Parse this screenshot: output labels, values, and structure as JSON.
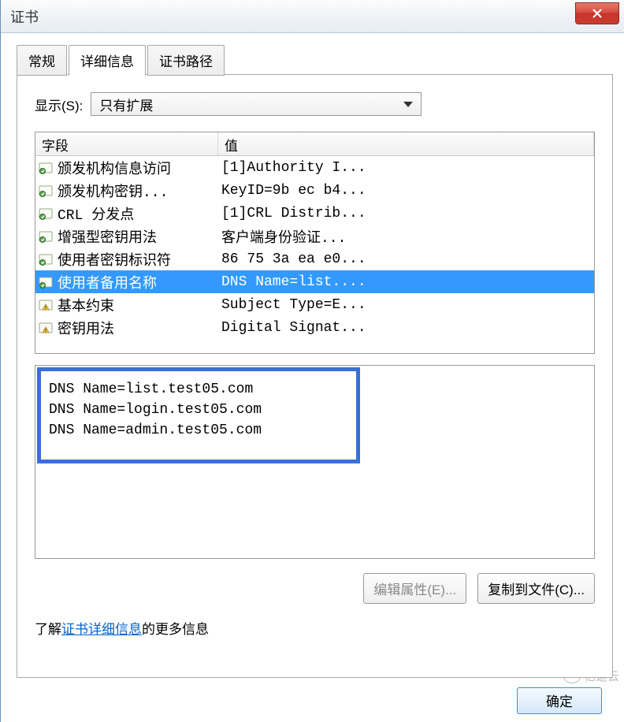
{
  "window": {
    "title": "证书"
  },
  "tabs": {
    "general": "常规",
    "details": "详细信息",
    "certpath": "证书路径"
  },
  "show": {
    "label": "显示(S):",
    "value": "只有扩展"
  },
  "table": {
    "header_field": "字段",
    "header_value": "值",
    "rows": [
      {
        "icon": "ext",
        "field": "颁发机构信息访问",
        "value": "[1]Authority I..."
      },
      {
        "icon": "ext",
        "field": "颁发机构密钥...",
        "value": "KeyID=9b ec b4..."
      },
      {
        "icon": "ext",
        "field": "CRL 分发点",
        "value": "[1]CRL Distrib..."
      },
      {
        "icon": "ext",
        "field": "增强型密钥用法",
        "value": "客户端身份验证..."
      },
      {
        "icon": "ext",
        "field": "使用者密钥标识符",
        "value": "86 75 3a ea e0..."
      },
      {
        "icon": "ext",
        "field": "使用者备用名称",
        "value": "DNS Name=list....",
        "selected": true
      },
      {
        "icon": "warn",
        "field": "基本约束",
        "value": "Subject Type=E..."
      },
      {
        "icon": "warn",
        "field": "密钥用法",
        "value": "Digital Signat..."
      }
    ]
  },
  "detail": {
    "lines": [
      "DNS Name=list.test05.com",
      "DNS Name=login.test05.com",
      "DNS Name=admin.test05.com"
    ]
  },
  "buttons": {
    "edit": "编辑属性(E)...",
    "copy": "复制到文件(C)...",
    "ok": "确定"
  },
  "info": {
    "prefix": "了解",
    "link": "证书详细信息",
    "suffix": "的更多信息"
  },
  "watermark": "亿速云"
}
